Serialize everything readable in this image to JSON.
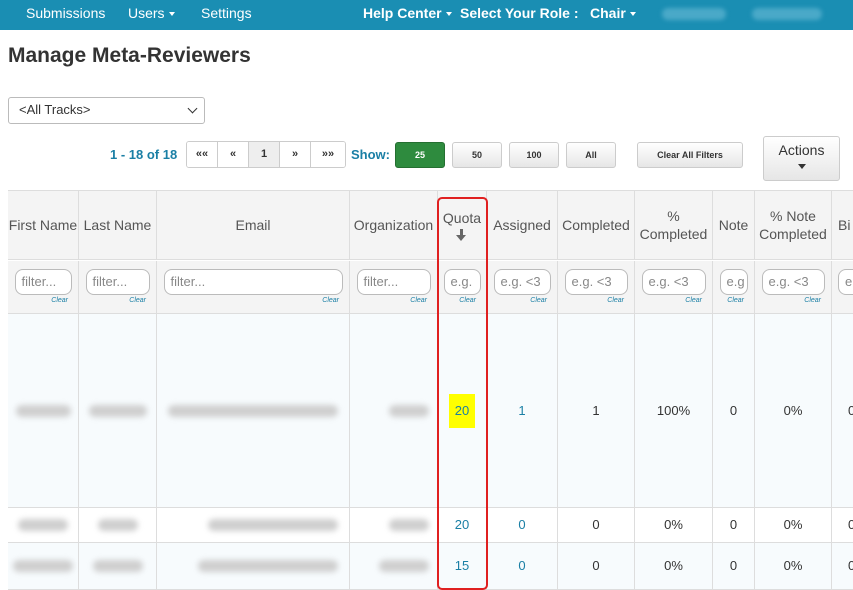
{
  "nav": {
    "submissions": "Submissions",
    "users": "Users",
    "settings": "Settings",
    "help_center": "Help Center",
    "select_role": "Select Your Role :",
    "role": "Chair"
  },
  "page_title": "Manage Meta-Reviewers",
  "track_select": {
    "value": "<All Tracks>"
  },
  "pagination": {
    "range": "1 - 18 of 18",
    "first": "««",
    "prev": "«",
    "current": "1",
    "next": "»",
    "last": "»»"
  },
  "show": {
    "label": "Show:",
    "options": [
      "25",
      "50",
      "100",
      "All"
    ],
    "selected": "25"
  },
  "clear_filters": "Clear All Filters",
  "actions": "Actions",
  "table": {
    "columns": [
      "First Name",
      "Last Name",
      "Email",
      "Organization",
      "Quota",
      "Assigned",
      "Completed",
      "% Completed",
      "Note",
      "% Note Completed",
      "Bi"
    ],
    "filter_placeholders": [
      "filter...",
      "filter...",
      "filter...",
      "filter...",
      "e.g.",
      "e.g. <3",
      "e.g. <3",
      "e.g. <3",
      "e.g",
      "e.g. <3",
      "e"
    ],
    "clear_label": "Clear",
    "rows": [
      {
        "quota": "20",
        "assigned": "1",
        "completed": "1",
        "pct_completed": "100%",
        "note": "0",
        "pct_note": "0%",
        "bi": "0"
      },
      {
        "quota": "20",
        "assigned": "0",
        "completed": "0",
        "pct_completed": "0%",
        "note": "0",
        "pct_note": "0%",
        "bi": "0"
      },
      {
        "quota": "15",
        "assigned": "0",
        "completed": "0",
        "pct_completed": "0%",
        "note": "0",
        "pct_note": "0%",
        "bi": "0"
      }
    ]
  },
  "colors": {
    "nav_bg": "#1a8eb3",
    "link": "#1a7fa5",
    "active_button": "#2e8b3e",
    "highlight": "#ffff00",
    "annotation": "#e02020"
  }
}
